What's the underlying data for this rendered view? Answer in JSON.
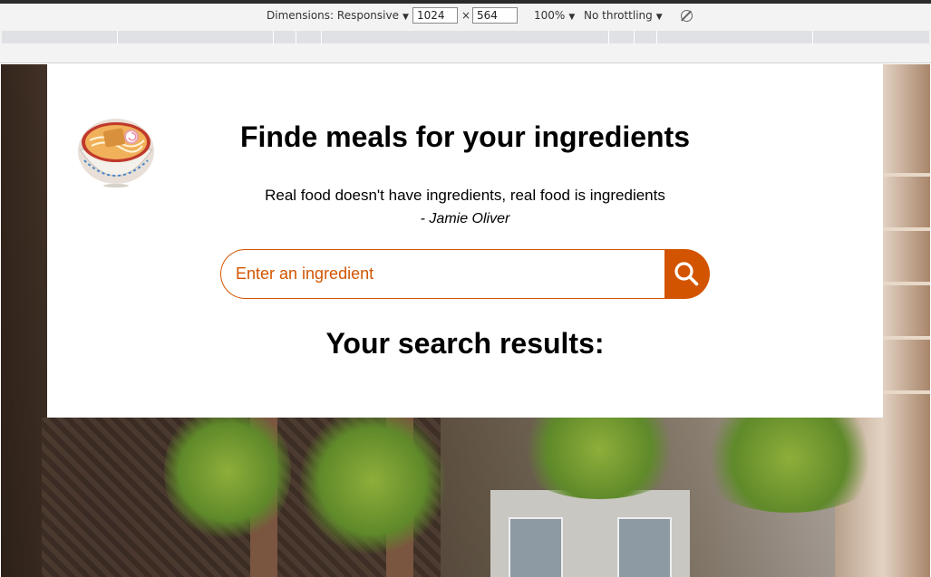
{
  "devtools": {
    "dimensions_label": "Dimensions: Responsive",
    "width_value": "1024",
    "times_sign": "×",
    "height_value": "564",
    "zoom_label": "100%",
    "throttling_label": "No throttling",
    "caret": "▼",
    "rotate_icon": "rotate-icon"
  },
  "page": {
    "title": "Finde meals for your ingredients",
    "quote": "Real food doesn't have ingredients, real food is ingredients",
    "author": "- Jamie Oliver",
    "search": {
      "placeholder": "Enter an ingredient",
      "button_icon": "search-icon"
    },
    "results_heading": "Your search results:",
    "logo_icon": "noodle-bowl-icon"
  },
  "colors": {
    "accent": "#d35400",
    "card_background": "#ffffff"
  }
}
